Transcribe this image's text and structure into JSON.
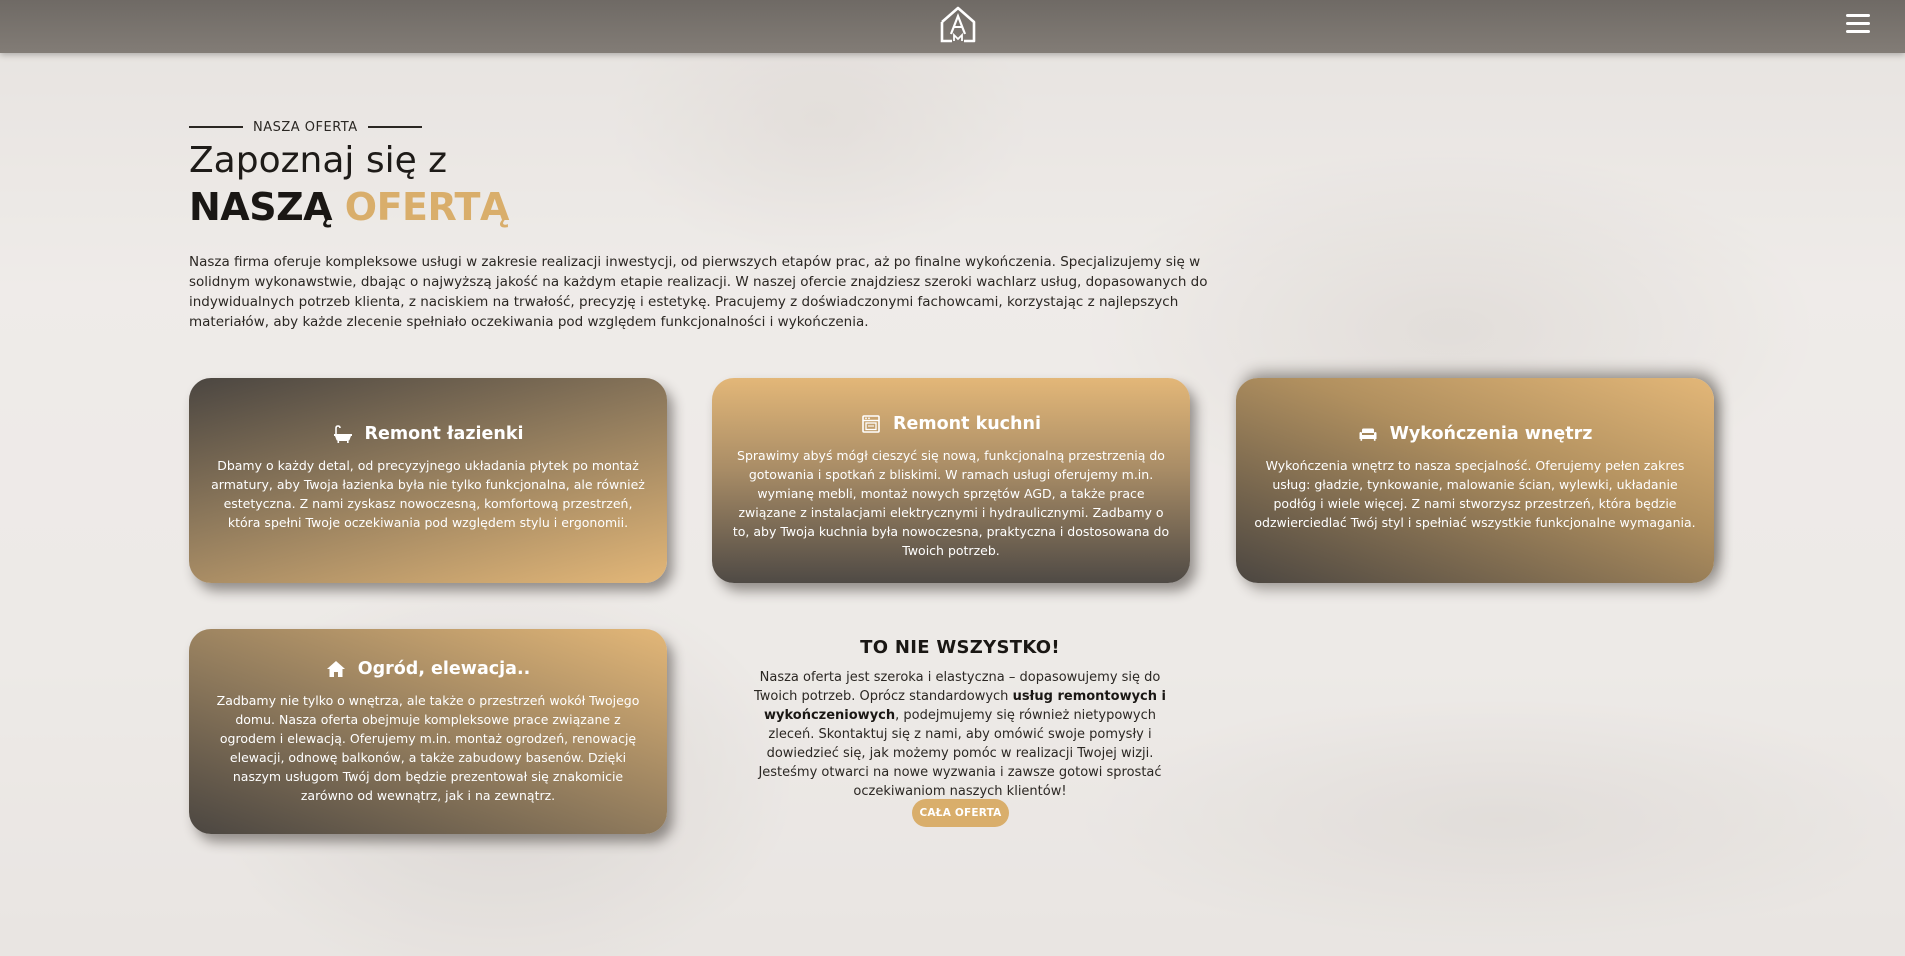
{
  "header": {
    "logo_text": "AM",
    "menu_icon": "hamburger-menu-icon"
  },
  "hero": {
    "eyebrow": "NASZA OFERTA",
    "title_light": "Zapoznaj się z",
    "title_bold_dark": "NASZĄ",
    "title_bold_gold": "OFERTĄ",
    "intro": "Nasza firma oferuje kompleksowe usługi w zakresie realizacji inwestycji, od pierwszych etapów prac, aż po finalne wykończenia. Specjalizujemy się w solidnym wykonawstwie, dbając o najwyższą jakość na każdym etapie realizacji. W naszej ofercie znajdziesz szeroki wachlarz usług, dopasowanych do indywidualnych potrzeb klienta, z naciskiem na trwałość, precyzję i estetykę. Pracujemy z doświadczonymi fachowcami, korzystając z najlepszych materiałów, aby każde zlecenie spełniało oczekiwania pod względem funkcjonalności i wykończenia."
  },
  "cards": [
    {
      "icon": "bathtub-icon",
      "title": "Remont łazienki",
      "text": "Dbamy o każdy detal, od precyzyjnego układania płytek po montaż armatury, aby Twoja łazienka była nie tylko funkcjonalna, ale również estetyczna. Z nami zyskasz nowoczesną, komfortową przestrzeń, która spełni Twoje oczekiwania pod względem stylu i ergonomii."
    },
    {
      "icon": "kitchen-stove-icon",
      "title": "Remont kuchni",
      "text": "Sprawimy abyś mógł cieszyć się nową, funkcjonalną przestrzenią do gotowania i spotkań z bliskimi. W ramach usługi oferujemy m.in. wymianę mebli, montaż nowych sprzętów AGD, a także prace związane z instalacjami elektrycznymi i hydraulicznymi. Zadbamy o to, aby Twoja kuchnia była nowoczesna, praktyczna i dostosowana do Twoich potrzeb."
    },
    {
      "icon": "sofa-icon",
      "title": "Wykończenia wnętrz",
      "text": "Wykończenia wnętrz to nasza specjalność. Oferujemy pełen zakres usług: gładzie, tynkowanie, malowanie ścian, wylewki, układanie podłóg i wiele więcej. Z nami stworzysz przestrzeń, która będzie odzwierciedlać Twój styl i spełniać wszystkie funkcjonalne wymagania."
    },
    {
      "icon": "house-icon",
      "title": "Ogród, elewacja..",
      "text": "Zadbamy nie tylko o wnętrza, ale także o przestrzeń wokół Twojego domu. Nasza oferta obejmuje kompleksowe prace związane z ogrodem i elewacją. Oferujemy m.in. montaż ogrodzeń, renowację elewacji, odnowę balkonów, a także zabudowy basenów. Dzięki naszym usługom Twój dom będzie prezentował się znakomicie zarówno od wewnątrz, jak i na zewnątrz."
    }
  ],
  "more": {
    "title": "TO NIE WSZYSTKO!",
    "text_part1": "Nasza oferta jest szeroka i elastyczna – dopasowujemy się do Twoich potrzeb. Oprócz standardowych ",
    "text_bold": "usług remontowych i wykończeniowych",
    "text_part2": ", podejmujemy się również nietypowych zleceń. Skontaktuj się z nami, aby omówić swoje pomysły i dowiedzieć się, jak możemy pomóc w realizacji Twojej wizji. Jesteśmy otwarci na nowe wyzwania i zawsze gotowi sprostać oczekiwaniom naszych klientów!",
    "button_label": "CAŁA OFERTA"
  },
  "colors": {
    "accent_gold": "#d9ae6b",
    "dark_brown": "#4b4641",
    "topbar": "#7a746f"
  }
}
